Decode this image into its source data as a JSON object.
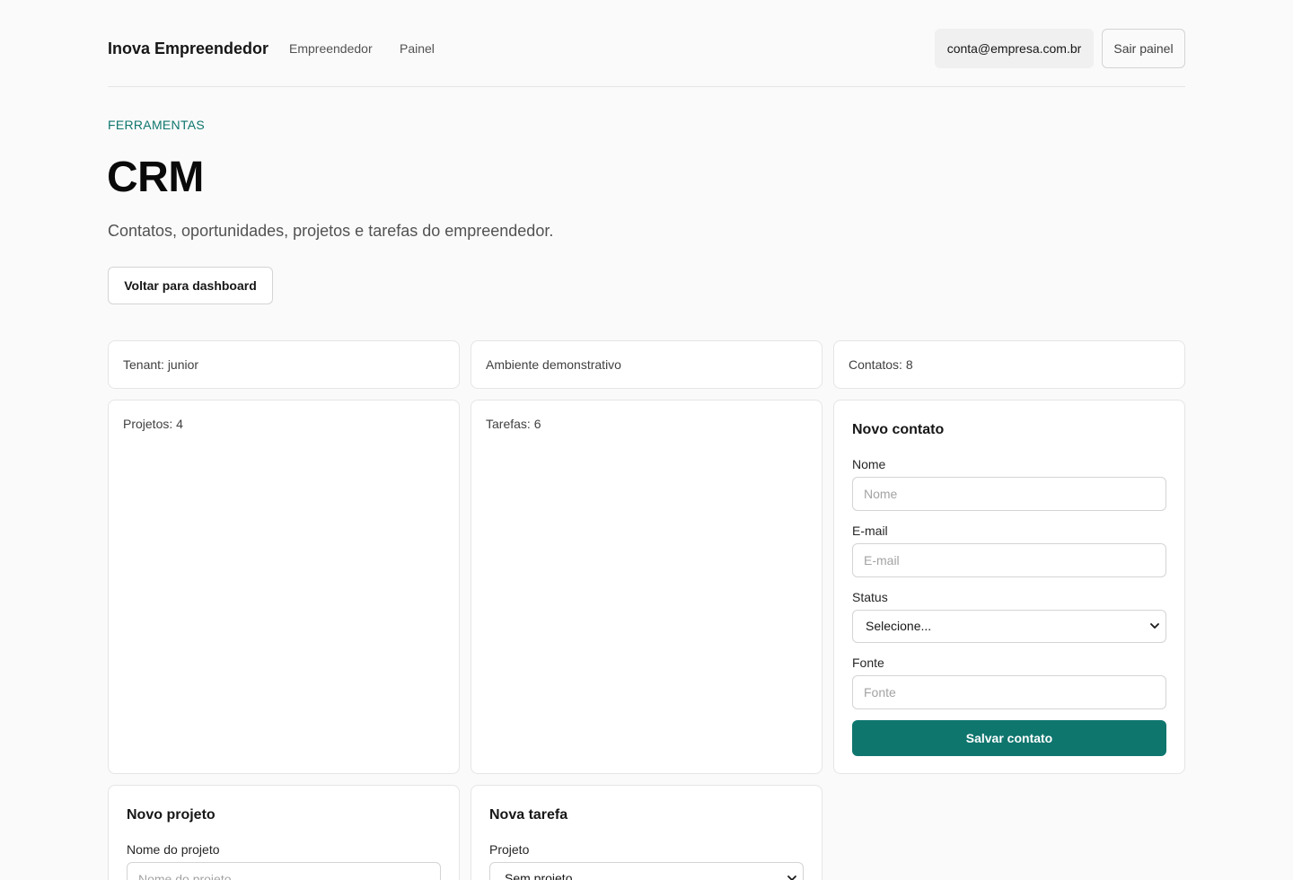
{
  "header": {
    "brand": "Inova Empreendedor",
    "nav": [
      "Empreendedor",
      "Painel"
    ],
    "account_email": "conta@empresa.com.br",
    "logout_label": "Sair painel"
  },
  "hero": {
    "eyebrow": "FERRAMENTAS",
    "title": "CRM",
    "subtitle": "Contatos, oportunidades, projetos e tarefas do empreendedor.",
    "back_label": "Voltar para dashboard"
  },
  "stats": {
    "tenant": "Tenant: junior",
    "environment": "Ambiente demonstrativo",
    "contacts": "Contatos: 8",
    "projects": "Projetos: 4",
    "tasks": "Tarefas: 6"
  },
  "contact_form": {
    "title": "Novo contato",
    "name_label": "Nome",
    "name_placeholder": "Nome",
    "email_label": "E-mail",
    "email_placeholder": "E-mail",
    "status_label": "Status",
    "status_value": "Selecione...",
    "source_label": "Fonte",
    "source_placeholder": "Fonte",
    "submit_label": "Salvar contato"
  },
  "project_form": {
    "title": "Novo projeto",
    "name_label": "Nome do projeto",
    "name_placeholder": "Nome do projeto"
  },
  "task_form": {
    "title": "Nova tarefa",
    "project_label": "Projeto",
    "project_value": "Sem projeto"
  },
  "colors": {
    "accent": "#0f766e",
    "background": "#fafafa",
    "card": "#ffffff",
    "border": "#e5e5e5"
  }
}
